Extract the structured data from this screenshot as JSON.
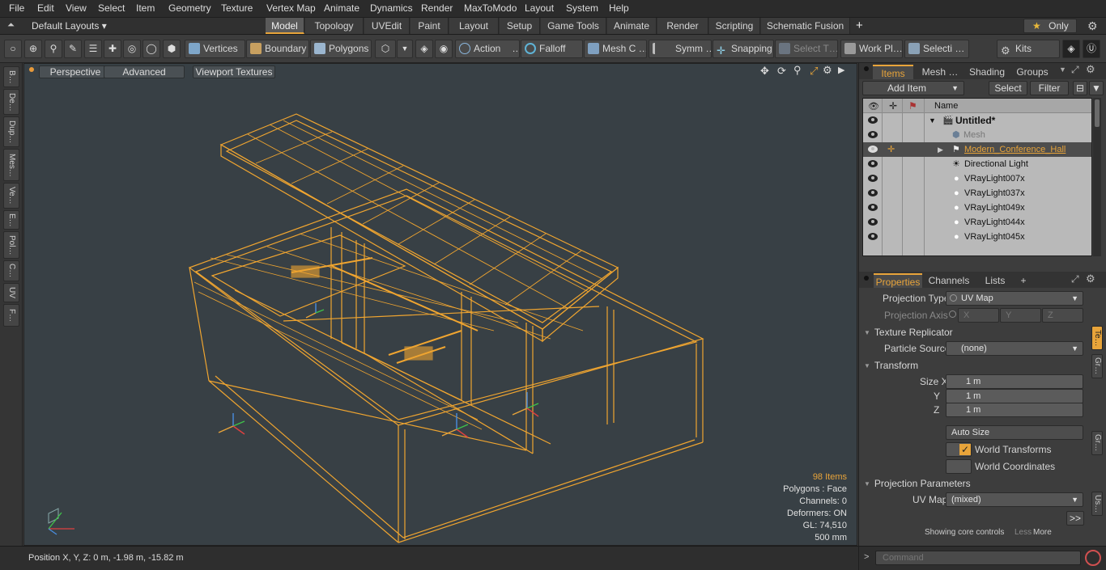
{
  "menubar": {
    "items": [
      "File",
      "Edit",
      "View",
      "Select",
      "Item",
      "Geometry",
      "Texture",
      "Vertex Map",
      "Animate",
      "Dynamics",
      "Render",
      "MaxToModo",
      "Layout",
      "System",
      "Help"
    ]
  },
  "layoutbar": {
    "layout_label": "Default Layouts ▾",
    "tabs": [
      "Model",
      "Topology",
      "UVEdit",
      "Paint",
      "Layout",
      "Setup",
      "Game Tools",
      "Animate",
      "Render",
      "Scripting",
      "Schematic Fusion"
    ],
    "add": "+",
    "only": "Only"
  },
  "toolbar": {
    "vertices": "Vertices",
    "boundary": "Boundary",
    "polygons": "Polygons",
    "action": "Action",
    "action_more": "…",
    "falloff": "Falloff",
    "meshc": "Mesh C …",
    "symm": "Symm …",
    "snapping": "Snapping",
    "selectt": "Select T…",
    "workpl": "Work Pl…",
    "selecti": "Selecti …",
    "kits": "Kits"
  },
  "lefttabs": [
    "B…",
    "De…",
    "Dup…",
    "Mes…",
    "Ve…",
    "E…",
    "Pol…",
    "C…",
    "UV",
    "F…"
  ],
  "viewport": {
    "perspective": "Perspective",
    "advanced": "Advanced",
    "viewport_textures": "Viewport Textures",
    "stats": {
      "items": "98 Items",
      "polygons": "Polygons : Face",
      "channels": "Channels: 0",
      "deformers": "Deformers: ON",
      "gl": "GL: 74,510",
      "scale": "500 mm"
    },
    "colors": {
      "wire": "#f0a530",
      "bg": "#384045"
    }
  },
  "statusbar": {
    "position": "Position X, Y, Z:   0 m, -1.98 m, -15.82 m"
  },
  "items_panel": {
    "tabs": [
      "Items",
      "Mesh …",
      "Shading",
      "Groups"
    ],
    "add_item": "Add Item",
    "select": "Select",
    "filter": "Filter",
    "name_header": "Name",
    "rows": [
      {
        "name": "Untitled*",
        "bold": true
      },
      {
        "name": "Mesh",
        "dim": true
      },
      {
        "name": "Modern_Conference_Hall",
        "selected": true
      },
      {
        "name": "Directional Light"
      },
      {
        "name": "VRayLight007x"
      },
      {
        "name": "VRayLight037x"
      },
      {
        "name": "VRayLight049x"
      },
      {
        "name": "VRayLight044x"
      },
      {
        "name": "VRayLight045x"
      }
    ]
  },
  "properties": {
    "tabs": [
      "Properties",
      "Channels",
      "Lists",
      "+"
    ],
    "projection_type_label": "Projection Type",
    "projection_type": "UV Map",
    "projection_axis_label": "Projection Axis",
    "axis_x": "X",
    "axis_y": "Y",
    "axis_z": "Z",
    "texture_replicator": "Texture Replicator",
    "particle_source_label": "Particle Source",
    "particle_source": "(none)",
    "transform": "Transform",
    "size_x_label": "Size X",
    "y_label": "Y",
    "z_label": "Z",
    "size_x": "1 m",
    "size_y": "1 m",
    "size_z": "1 m",
    "auto_size": "Auto Size",
    "world_transforms": "World Transforms",
    "world_coordinates": "World Coordinates",
    "projection_parameters": "Projection Parameters",
    "uv_map_label": "UV Map",
    "uv_map": "(mixed)",
    "showing": "Showing core controls",
    "less": "Less",
    "more": "More",
    "more_btn": ">>",
    "side_tabs": [
      "Te…",
      "Gr…",
      "Gr…",
      "Us…"
    ]
  },
  "command": {
    "placeholder": "Command",
    "prompt": ">"
  }
}
